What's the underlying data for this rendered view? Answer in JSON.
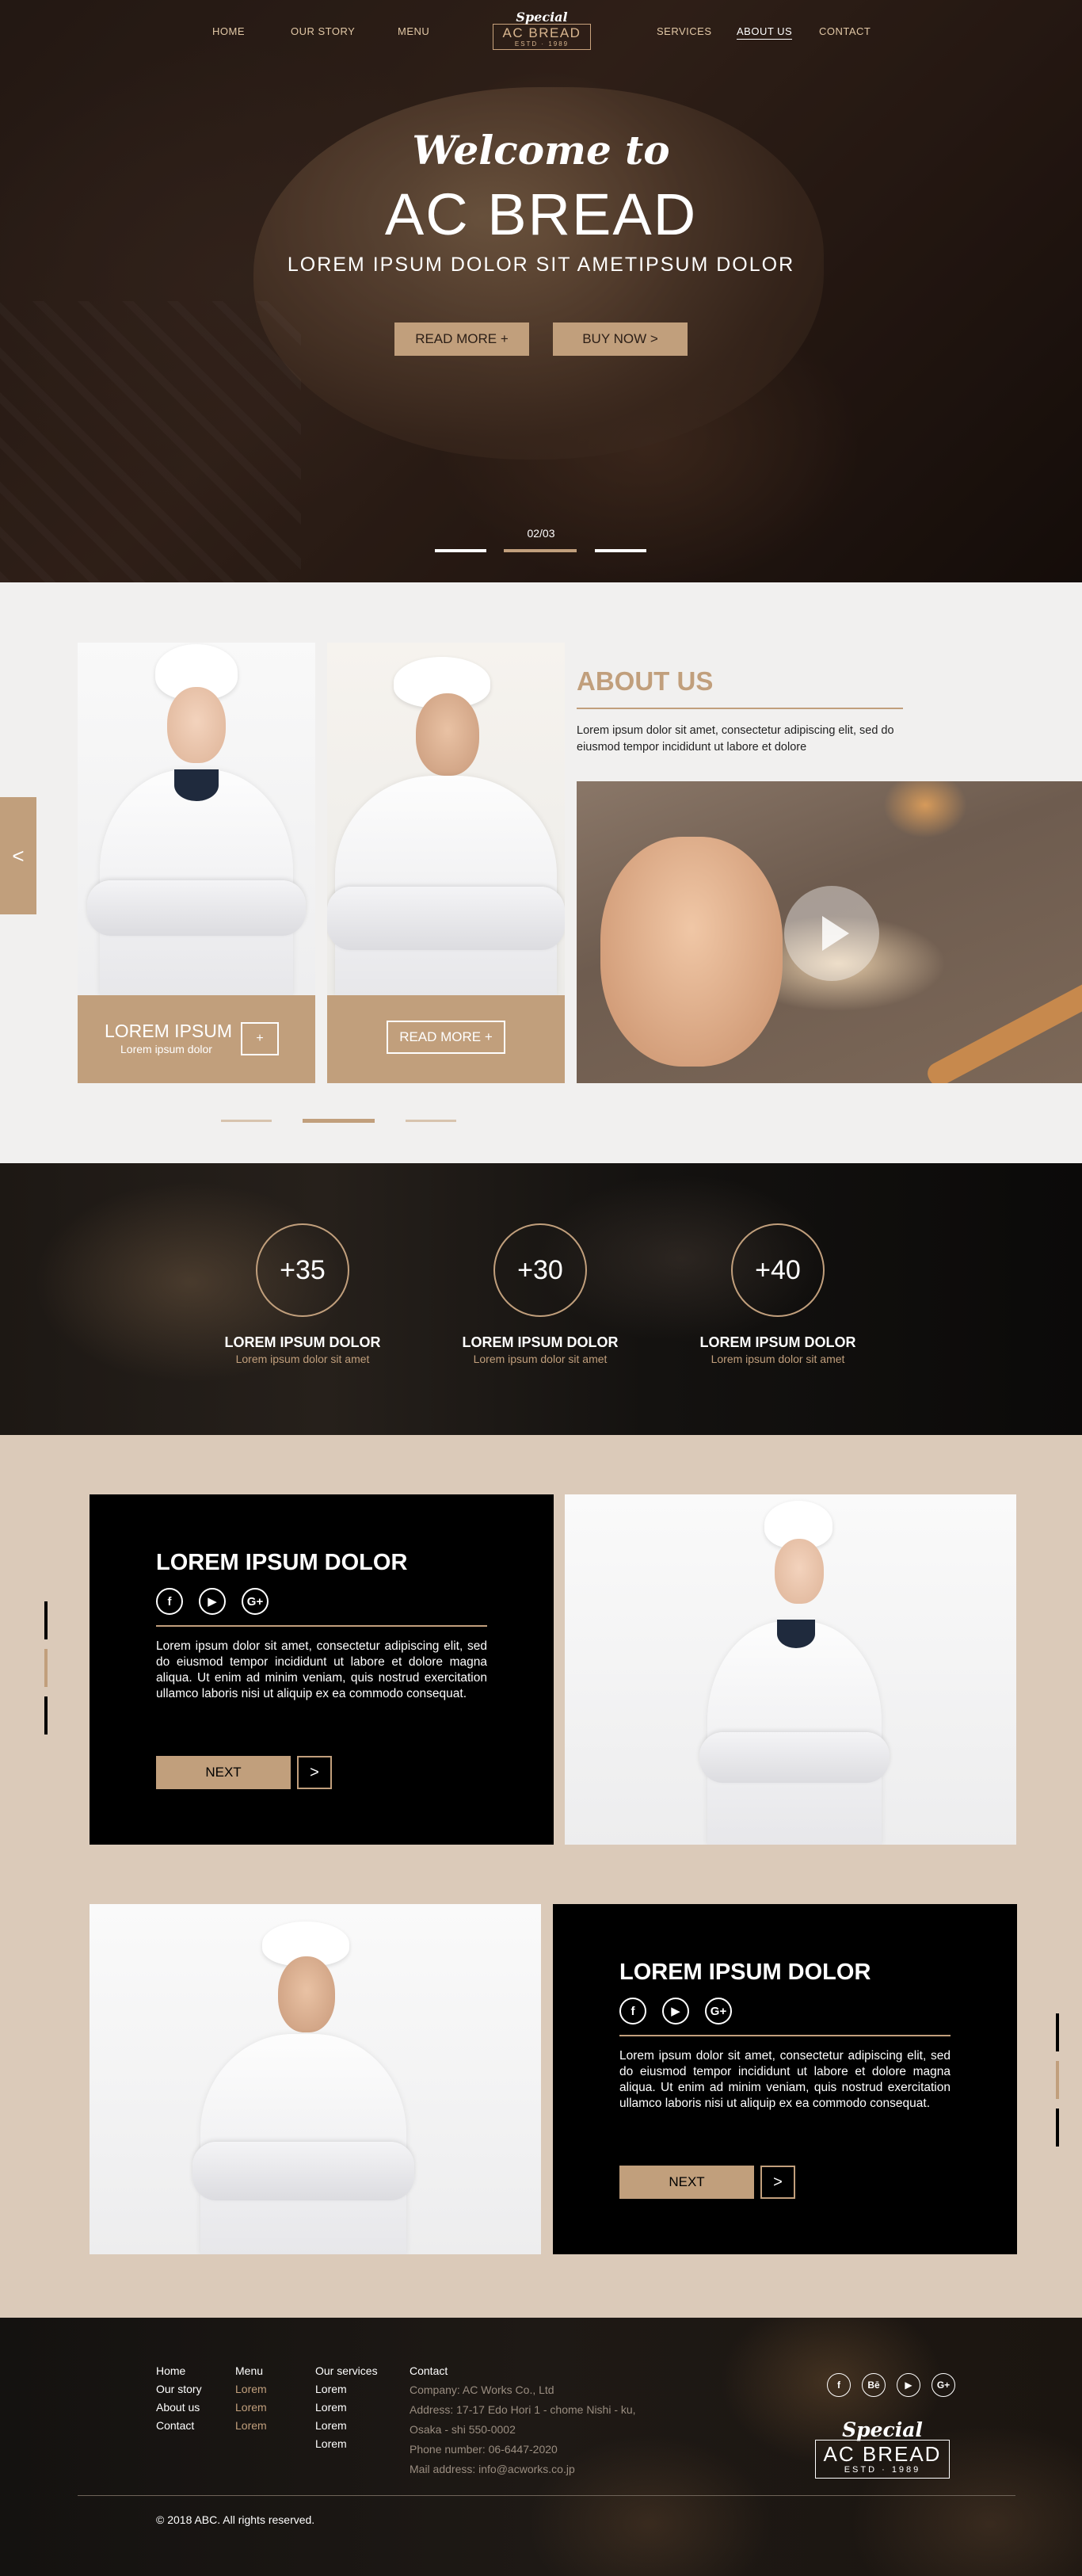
{
  "nav": {
    "items": [
      "HOME",
      "OUR STORY",
      "MENU",
      "SERVICES",
      "ABOUT US",
      "CONTACT"
    ],
    "active": "ABOUT US"
  },
  "logo": {
    "special": "Special",
    "name": "AC BREAD",
    "estd": "ESTD · 1989"
  },
  "hero": {
    "welcome": "Welcome to",
    "brand": "AC BREAD",
    "tagline": "LOREM IPSUM DOLOR SIT AMETIPSUM DOLOR",
    "read_more": "READ MORE  +",
    "buy_now": "BUY NOW >",
    "counter": "02/03",
    "active_slide": 2,
    "slides": 3
  },
  "about": {
    "prev_icon": "<",
    "card1": {
      "title": "LOREM IPSUM",
      "subtitle": "Lorem ipsum dolor",
      "plus": "+"
    },
    "card2": {
      "button": "READ MORE  +"
    },
    "title": "ABOUT US",
    "text": "Lorem ipsum dolor sit amet, consectetur adipiscing elit, sed do eiusmod tempor incididunt ut labore et dolore",
    "video_icon": "play-icon",
    "pager_active": 2
  },
  "stats": [
    {
      "value": "+35",
      "label": "LOREM IPSUM DOLOR",
      "sub": "Lorem ipsum dolor sit amet"
    },
    {
      "value": "+30",
      "label": "LOREM IPSUM DOLOR",
      "sub": "Lorem ipsum dolor sit amet"
    },
    {
      "value": "+40",
      "label": "LOREM IPSUM DOLOR",
      "sub": "Lorem ipsum dolor sit amet"
    }
  ],
  "features": [
    {
      "title": "LOREM IPSUM DOLOR",
      "text": "Lorem ipsum dolor sit amet, consectetur adipiscing elit, sed do eiusmod tempor incididunt ut labore et dolore magna aliqua. Ut enim ad minim veniam, quis nostrud exercitation ullamco laboris nisi ut aliquip ex ea commodo consequat.",
      "next": "NEXT",
      "arrow": ">"
    },
    {
      "title": "LOREM IPSUM DOLOR",
      "text": "Lorem ipsum dolor sit amet, consectetur adipiscing elit, sed do eiusmod tempor incididunt ut labore et dolore magna aliqua. Ut enim ad minim veniam, quis nostrud exercitation ullamco laboris nisi ut aliquip ex ea commodo consequat.",
      "next": "NEXT",
      "arrow": ">"
    }
  ],
  "social_icons": [
    "f",
    "▶",
    "G+"
  ],
  "footer": {
    "col_home": [
      "Home",
      "Our story",
      "About us",
      "Contact"
    ],
    "col_menu": {
      "title": "Menu",
      "items": [
        "Lorem",
        "Lorem",
        "Lorem"
      ]
    },
    "col_services": {
      "title": "Our services",
      "items": [
        "Lorem",
        "Lorem",
        "Lorem",
        "Lorem"
      ]
    },
    "col_contact": {
      "title": "Contact",
      "items": [
        "Company: AC Works Co., Ltd",
        "Address: 17-17 Edo Hori 1 - chome Nishi - ku,",
        "Osaka - shi 550-0002",
        "Phone number: 06-6447-2020",
        "Mail address: info@acworks.co.jp"
      ]
    },
    "social": [
      "f",
      "Bē",
      "▶",
      "G+"
    ],
    "copyright": "© 2018 ABC. All rights reserved."
  },
  "colors": {
    "accent": "#c19f7c",
    "beige_bg": "#dbcab9",
    "light_bg": "#f1f0ef"
  }
}
